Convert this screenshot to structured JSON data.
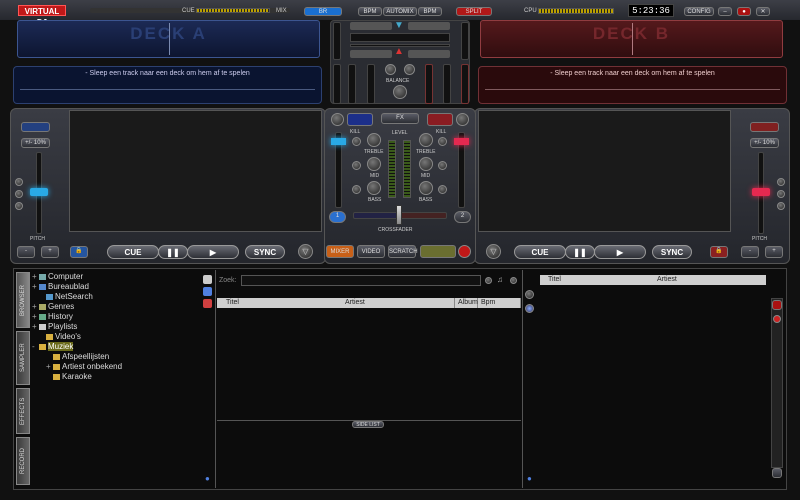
{
  "app": {
    "logo": "VIRTUAL DJ",
    "time": "5:23:36"
  },
  "topbar": {
    "cue_label": "CUE",
    "mix_label": "MIX",
    "btn_mix": "BR",
    "pitch_btns": [
      "BPM",
      "AUTOMIX",
      "BPM"
    ],
    "split_label": "SPLIT",
    "cpu_label": "CPU",
    "config": "CONFIG",
    "cpu_level": 0.75,
    "cue_mix_level": 0.5
  },
  "deckA": {
    "label": "DECK A",
    "info": "- Sleep een track naar een deck om hem af te spelen",
    "pitch": "+/- 10%",
    "pitch_label": "PITCH",
    "cue": "CUE",
    "sync": "SYNC",
    "minus": "-",
    "plus": "+"
  },
  "deckB": {
    "label": "DECK B",
    "info": "- Sleep een track naar een deck om hem af te spelen",
    "pitch": "+/- 10%",
    "pitch_label": "PITCH",
    "cue": "CUE",
    "sync": "SYNC",
    "minus": "-",
    "plus": "+"
  },
  "mixer": {
    "balance": "BALANCE",
    "kill": "KILL",
    "level": "LEVEL",
    "treble": "TREBLE",
    "mid": "MID",
    "bass": "BASS",
    "crossfader": "CROSSFADER",
    "fx_center": "FX",
    "deck_nums": [
      "1",
      "2"
    ],
    "mixer_tabs": [
      "MIXER",
      "VIDEO",
      "SCRATCH"
    ],
    "crossfader_position": 0.5
  },
  "browser": {
    "side_tabs": [
      "BROWSER",
      "SAMPLER",
      "EFFECTS",
      "RECORD"
    ],
    "tree": [
      {
        "label": "Computer",
        "indent": 0,
        "expander": "+",
        "icon": "computer-icon"
      },
      {
        "label": "Bureaublad",
        "indent": 0,
        "expander": "+",
        "icon": "desktop-icon"
      },
      {
        "label": "NetSearch",
        "indent": 1,
        "expander": "",
        "icon": "netsearch-icon"
      },
      {
        "label": "Genres",
        "indent": 0,
        "expander": "+",
        "icon": "genres-icon"
      },
      {
        "label": "History",
        "indent": 0,
        "expander": "+",
        "icon": "history-icon"
      },
      {
        "label": "Playlists",
        "indent": 0,
        "expander": "+",
        "icon": "playlist-icon"
      },
      {
        "label": "Video's",
        "indent": 1,
        "expander": "",
        "icon": "folder-icon"
      },
      {
        "label": "Muziek",
        "indent": 0,
        "expander": "-",
        "icon": "folder-icon",
        "selected": true
      },
      {
        "label": "Afspeellijsten",
        "indent": 2,
        "expander": "",
        "icon": "folder-icon"
      },
      {
        "label": "Artiest onbekend",
        "indent": 2,
        "expander": "+",
        "icon": "folder-icon"
      },
      {
        "label": "Karaoke",
        "indent": 2,
        "expander": "",
        "icon": "folder-icon"
      }
    ],
    "search_label": "Zoek:",
    "search_value": "",
    "columns": [
      "Titel",
      "Artiest",
      "Album",
      "Bpm"
    ],
    "side_list_label": "SIDE LIST",
    "right_columns": [
      "Titel",
      "Artiest"
    ]
  }
}
